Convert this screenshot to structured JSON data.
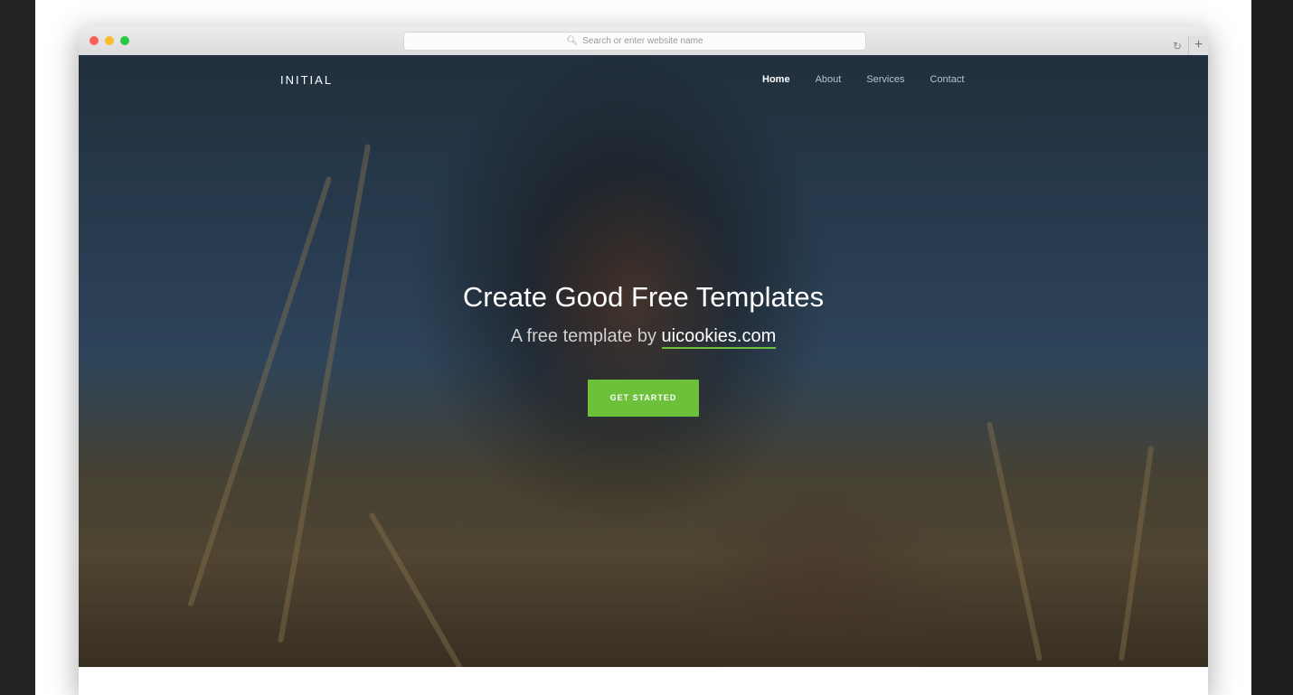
{
  "browser": {
    "address_placeholder": "Search or enter website name",
    "new_tab_symbol": "+"
  },
  "site": {
    "logo": "INITIAL",
    "nav": [
      {
        "label": "Home",
        "active": true
      },
      {
        "label": "About",
        "active": false
      },
      {
        "label": "Services",
        "active": false
      },
      {
        "label": "Contact",
        "active": false
      }
    ]
  },
  "hero": {
    "title": "Create Good Free Templates",
    "subtitle_prefix": "A free template by",
    "subtitle_link": "uicookies.com",
    "cta_label": "GET STARTED"
  },
  "colors": {
    "accent": "#6cc03a",
    "nav_text": "#b9c2ca",
    "traffic_red": "#fc5f57",
    "traffic_yellow": "#fdbb2d",
    "traffic_green": "#28c941"
  }
}
